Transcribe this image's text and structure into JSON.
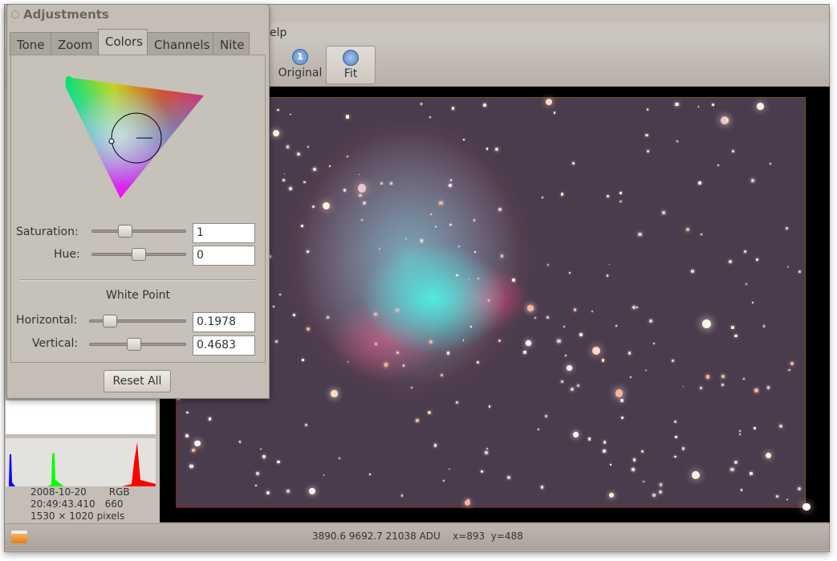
{
  "main": {
    "menu_partial": "elp",
    "toolbar": [
      {
        "label": "Original",
        "icon": "zoom-original-icon"
      },
      {
        "label": "Fit",
        "icon": "zoom-fit-icon"
      }
    ],
    "info": {
      "date": "2008-10-20",
      "mode": "RGB",
      "time": "20:49:43.410",
      "value": "660",
      "size": "1530 × 1020 pixels"
    },
    "status": "3890.6 9692.7 21038 ADU    x=893  y=488",
    "histogram_colors": [
      "#0000ff",
      "#00ff00",
      "#ff0000"
    ]
  },
  "adjustments": {
    "title": "Adjustments",
    "tabs": [
      "Tone",
      "Zoom",
      "Colors",
      "Channels",
      "Nite"
    ],
    "active_tab": "Colors",
    "saturation": {
      "label": "Saturation:",
      "value": "1",
      "level": 0.3
    },
    "hue": {
      "label": "Hue:",
      "value": "0",
      "level": 0.5
    },
    "white_point": "White Point",
    "horizontal": {
      "label": "Horizontal:",
      "value": "0.1978",
      "level": 0.2
    },
    "vertical": {
      "label": "Vertical:",
      "value": "0.4683",
      "level": 0.47
    },
    "reset": "Reset All"
  }
}
